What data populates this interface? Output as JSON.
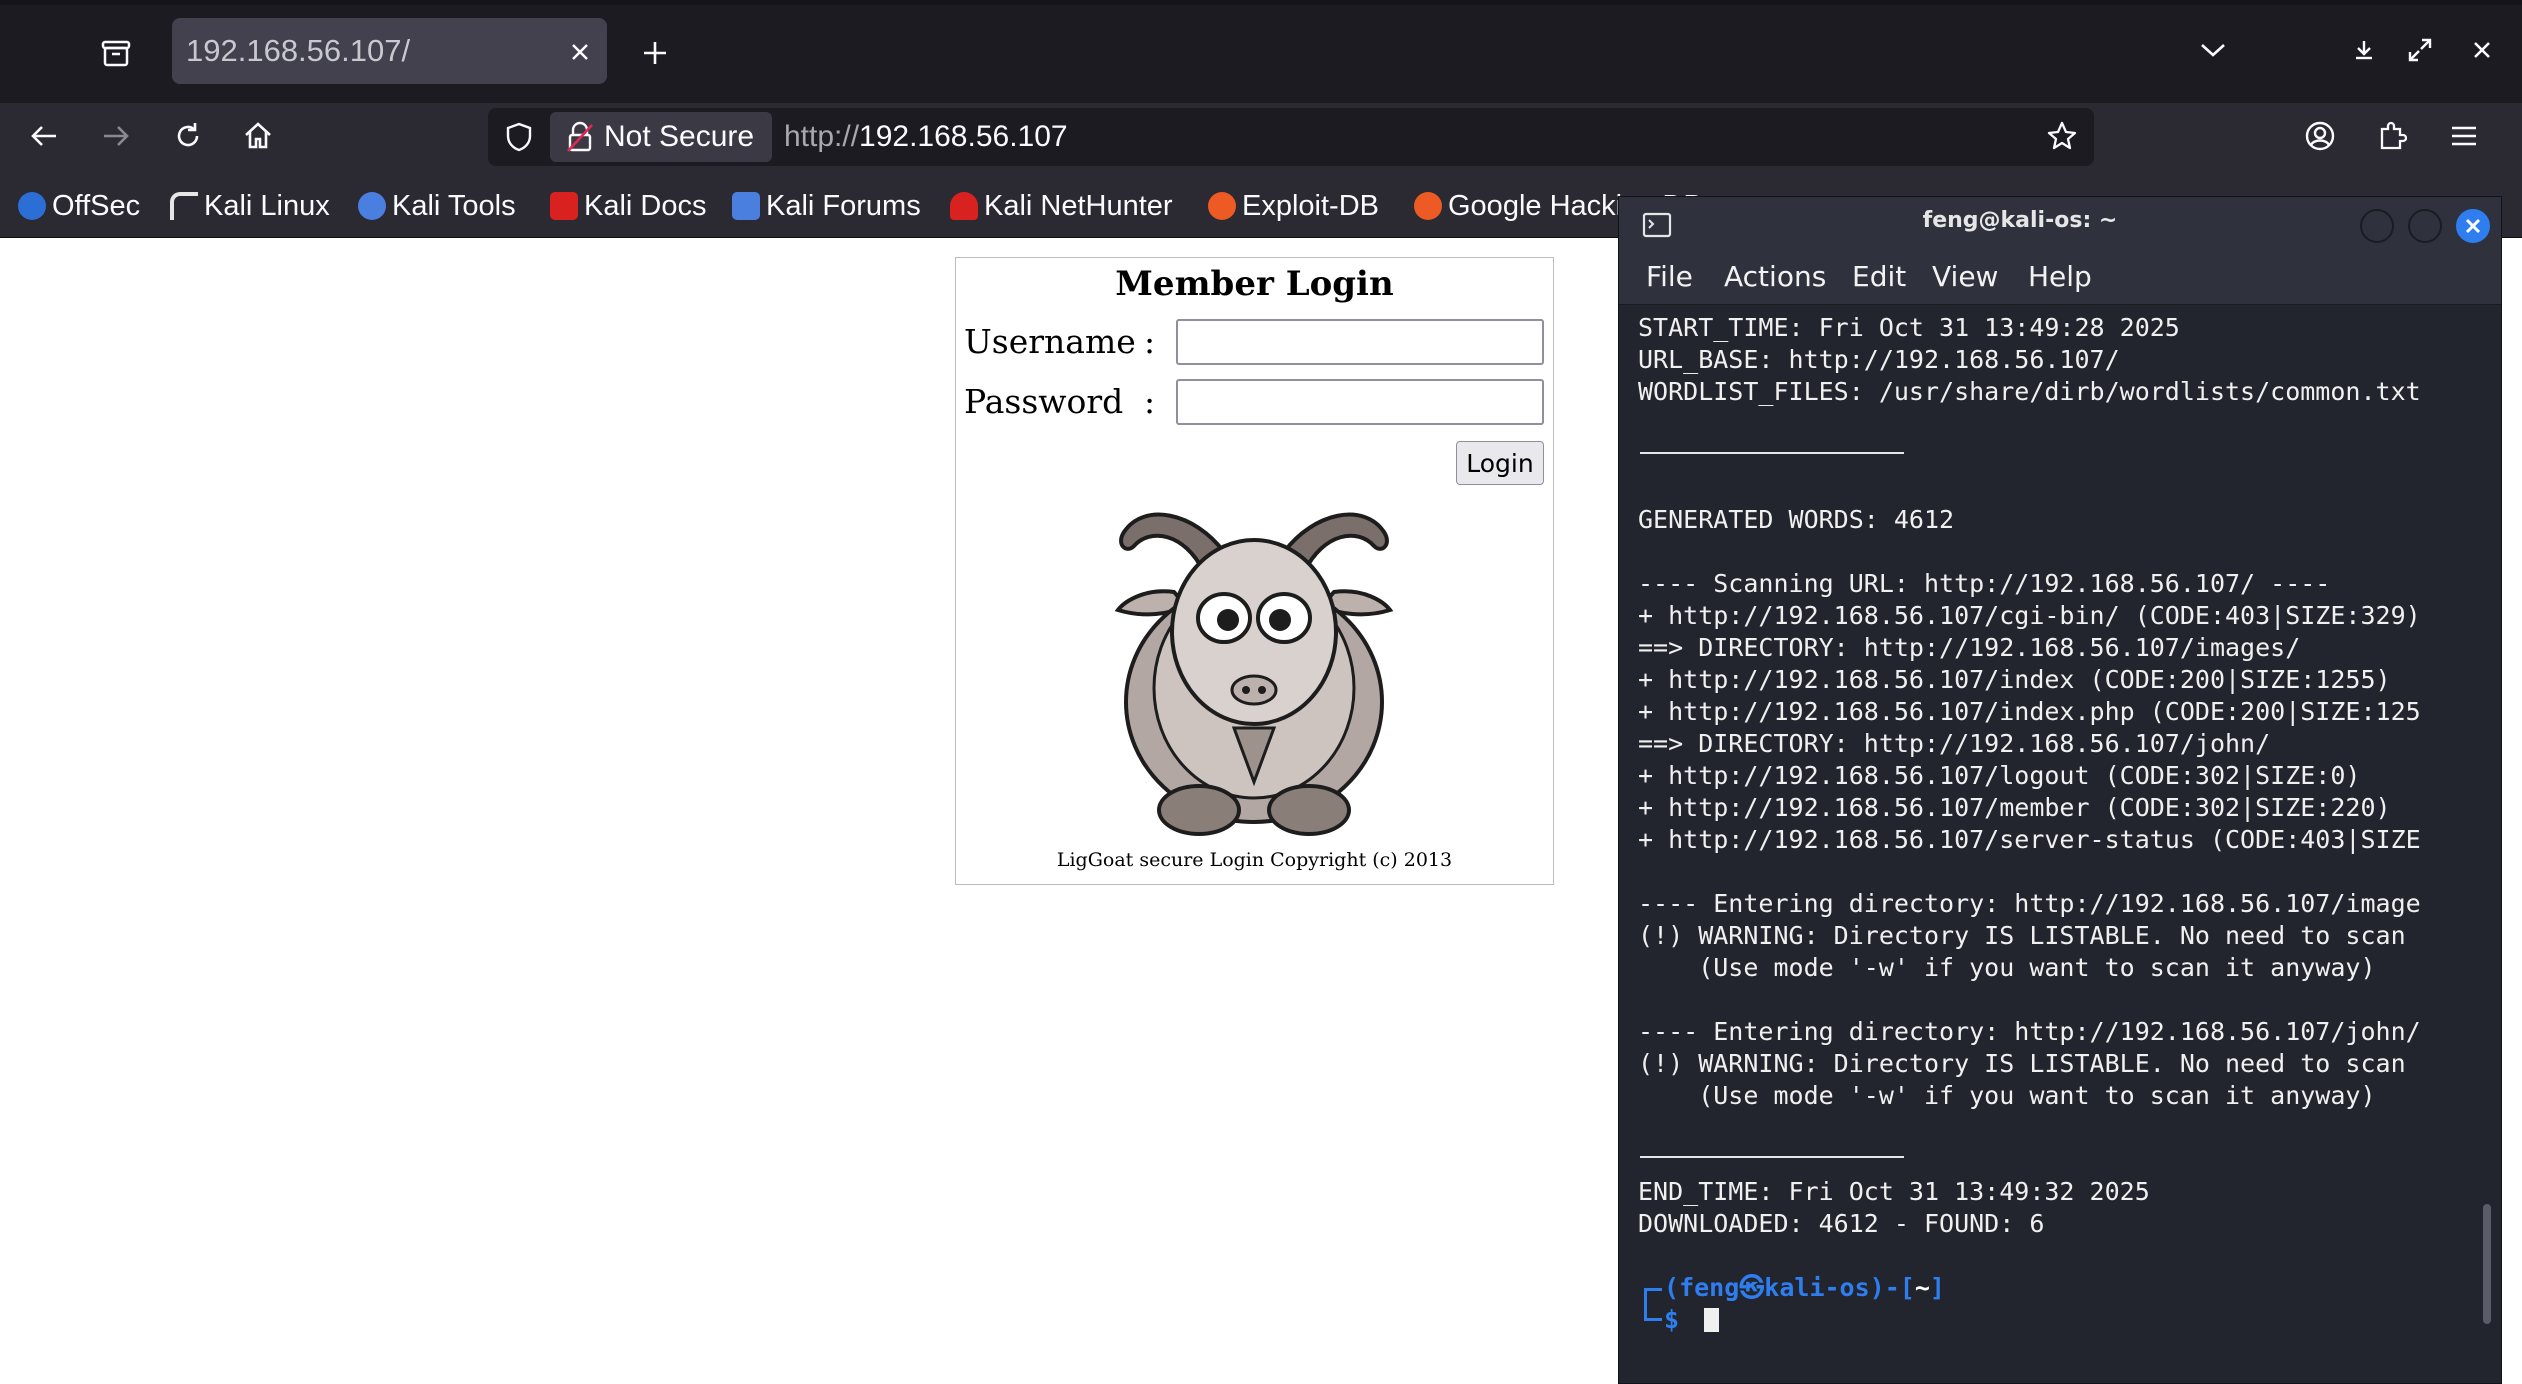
{
  "browser": {
    "tab": {
      "title": "192.168.56.107/"
    },
    "security_label": "Not Secure",
    "url_prefix": "http://",
    "url_host": "192.168.56.107",
    "bookmarks": [
      {
        "label": "OffSec",
        "color": "#2b6fd6"
      },
      {
        "label": "Kali Linux",
        "color": "#e6e6e6"
      },
      {
        "label": "Kali Tools",
        "color": "#4a7fe0"
      },
      {
        "label": "Kali Docs",
        "color": "#d9221f"
      },
      {
        "label": "Kali Forums",
        "color": "#4a7fe0"
      },
      {
        "label": "Kali NetHunter",
        "color": "#d9221f"
      },
      {
        "label": "Exploit-DB",
        "color": "#ee5a24"
      },
      {
        "label": "Google Hacking DB",
        "color": "#ee5a24"
      }
    ]
  },
  "page": {
    "title": "Member Login",
    "username_label": "Username",
    "password_label": "Password",
    "colon": ":",
    "username_value": "",
    "password_value": "",
    "login_button": "Login",
    "copyright": "LigGoat secure Login Copyright (c) 2013"
  },
  "terminal": {
    "title": "feng@kali-os: ~",
    "menu": [
      "File",
      "Actions",
      "Edit",
      "View",
      "Help"
    ],
    "lines": [
      "START_TIME: Fri Oct 31 13:49:28 2025",
      "URL_BASE: http://192.168.56.107/",
      "WORDLIST_FILES: /usr/share/dirb/wordlists/common.txt",
      "GENERATED WORDS: 4612",
      "---- Scanning URL: http://192.168.56.107/ ----",
      "+ http://192.168.56.107/cgi-bin/ (CODE:403|SIZE:329)",
      "==> DIRECTORY: http://192.168.56.107/images/",
      "+ http://192.168.56.107/index (CODE:200|SIZE:1255)",
      "+ http://192.168.56.107/index.php (CODE:200|SIZE:125",
      "==> DIRECTORY: http://192.168.56.107/john/",
      "+ http://192.168.56.107/logout (CODE:302|SIZE:0)",
      "+ http://192.168.56.107/member (CODE:302|SIZE:220)",
      "+ http://192.168.56.107/server-status (CODE:403|SIZE",
      "---- Entering directory: http://192.168.56.107/image",
      "(!) WARNING: Directory IS LISTABLE. No need to scan",
      "    (Use mode '-w' if you want to scan it anyway)",
      "---- Entering directory: http://192.168.56.107/john/",
      "(!) WARNING: Directory IS LISTABLE. No need to scan",
      "    (Use mode '-w' if you want to scan it anyway)",
      "END_TIME: Fri Oct 31 13:49:32 2025",
      "DOWNLOADED: 4612 - FOUND: 6"
    ],
    "prompt": {
      "open": "(",
      "user": "feng",
      "at": "㉿",
      "host": "kali-os",
      "mid": ")-[",
      "dir": "~",
      "close": "]",
      "symbol": "$"
    }
  }
}
